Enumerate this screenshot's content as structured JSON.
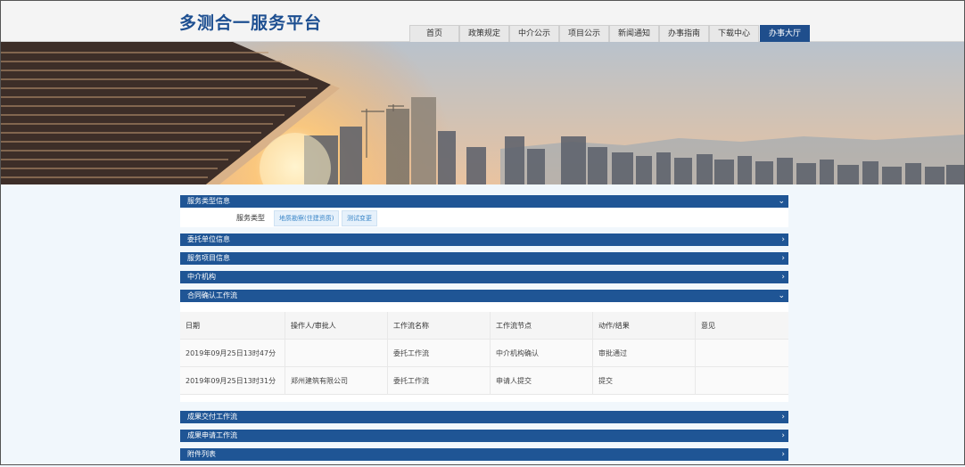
{
  "header": {
    "logo": "多测合一服务平台",
    "nav": [
      "首页",
      "政策规定",
      "中介公示",
      "项目公示",
      "新闻通知",
      "办事指南",
      "下载中心",
      "办事大厅"
    ]
  },
  "sections": {
    "service_type": {
      "title": "服务类型信息",
      "label": "服务类型",
      "tags": [
        "地质勘察(住建资质)",
        "测试变更"
      ]
    },
    "client": {
      "title": "委托单位信息"
    },
    "project": {
      "title": "服务项目信息"
    },
    "agency": {
      "title": "中介机构"
    },
    "contract": {
      "title": "合同确认工作流",
      "columns": [
        "日期",
        "操作人/审批人",
        "工作流名称",
        "工作流节点",
        "动作/结果",
        "意见"
      ],
      "rows": [
        [
          "2019年09月25日13时47分",
          "",
          "委托工作流",
          "中介机构确认",
          "审批通过",
          ""
        ],
        [
          "2019年09月25日13时31分",
          "郑州建筑有限公司",
          "委托工作流",
          "申请人提交",
          "提交",
          ""
        ]
      ]
    },
    "delivery": {
      "title": "成果交付工作流"
    },
    "result_apply": {
      "title": "成果申请工作流"
    },
    "attachments": {
      "title": "附件列表"
    }
  },
  "icons": {
    "expanded": "chevron-down-icon",
    "collapsed": "chevron-right-icon"
  },
  "colors": {
    "brand": "#1d4f91",
    "section_bar": "#1f5595",
    "tag_text": "#3a86c8"
  }
}
